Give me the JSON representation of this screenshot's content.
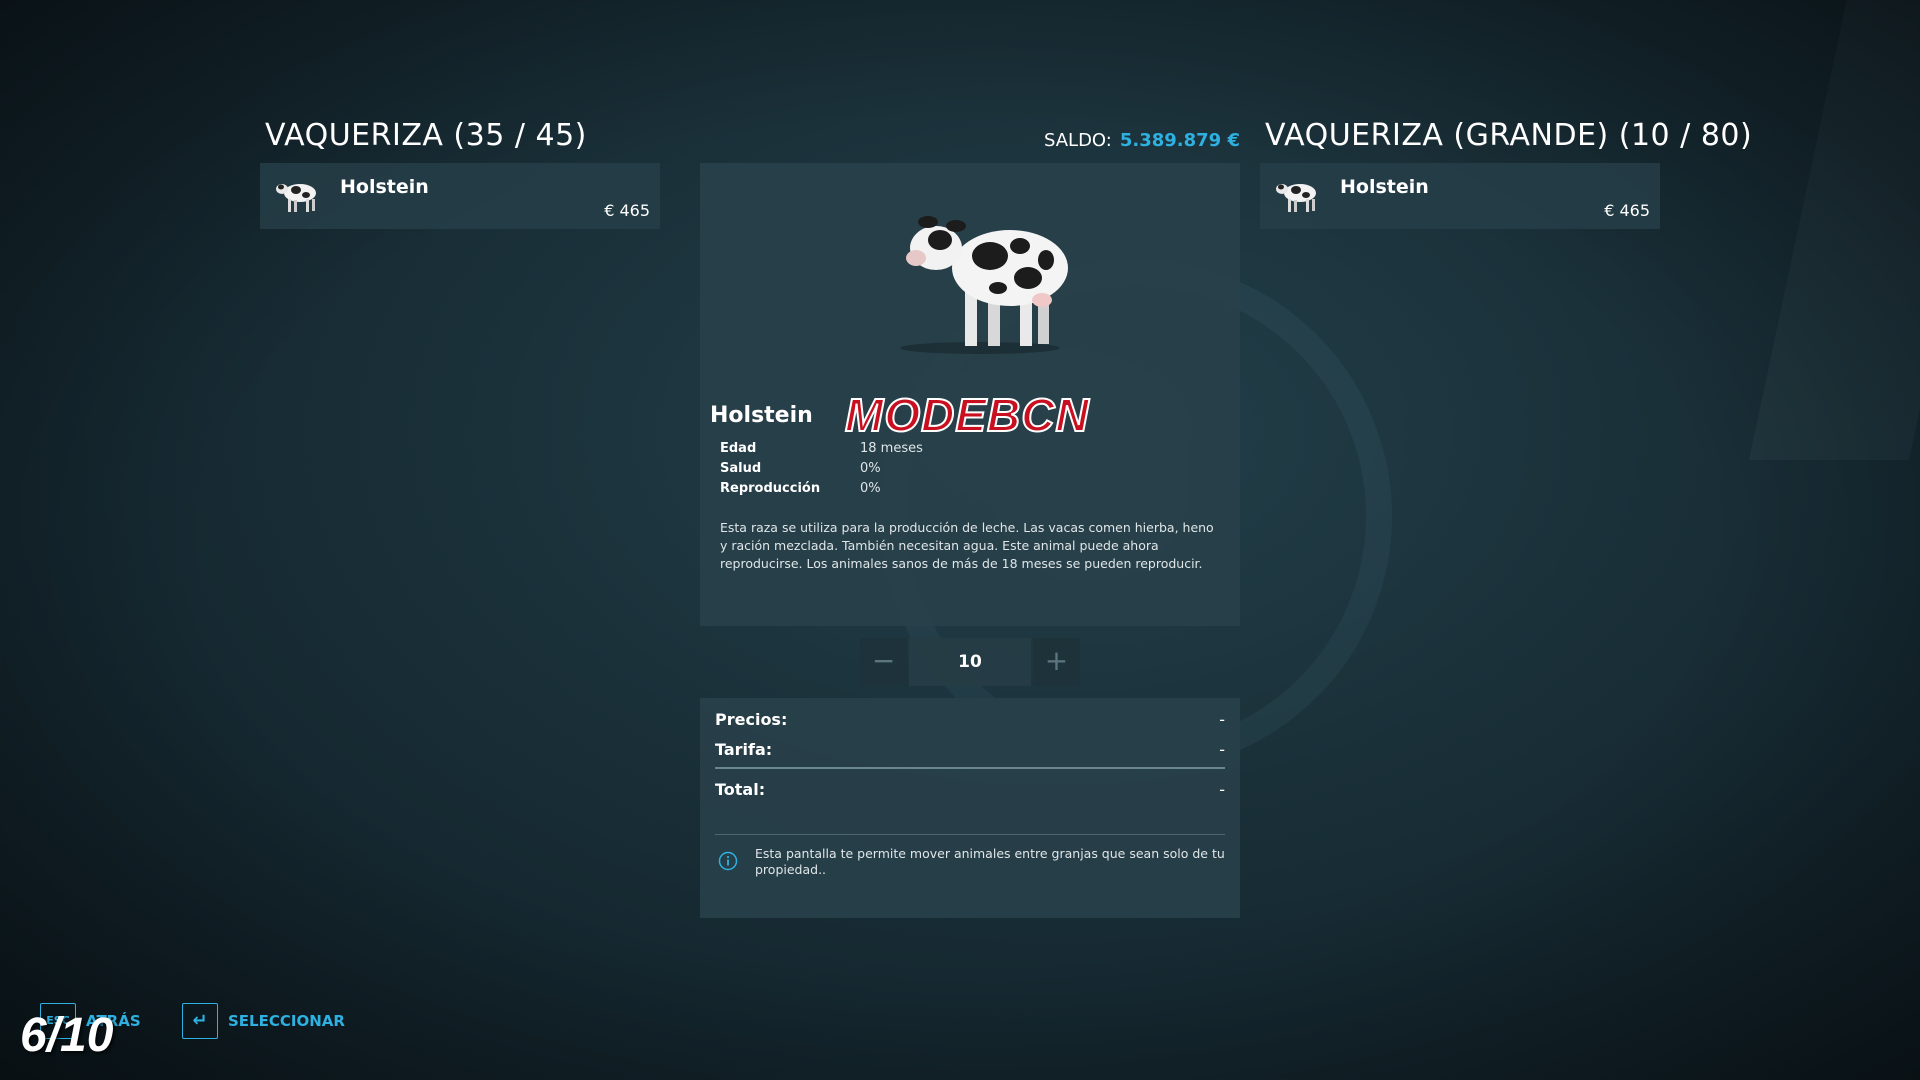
{
  "header": {
    "left_title": "VAQUERIZA (35 / 45)",
    "right_title": "VAQUERIZA (GRANDE) (10 / 80)",
    "balance_label": "SALDO:",
    "balance_value": "5.389.879 €"
  },
  "left_list": {
    "items": [
      {
        "name": "Holstein",
        "price": "€ 465"
      }
    ]
  },
  "right_list": {
    "items": [
      {
        "name": "Holstein",
        "price": "€ 465"
      }
    ]
  },
  "detail": {
    "name": "Holstein",
    "watermark": "MODEBCN",
    "stats": [
      {
        "label": "Edad",
        "value": "18 meses"
      },
      {
        "label": "Salud",
        "value": "0%"
      },
      {
        "label": "Reproducción",
        "value": "0%"
      }
    ],
    "description": "Esta raza se utiliza para la producción de leche. Las vacas comen hierba, heno y ración mezclada. También necesitan agua. Este animal puede ahora reproducirse. Los animales sanos de más de 18 meses se pueden reproducir."
  },
  "quantity": {
    "minus": "−",
    "value": "10",
    "plus": "+"
  },
  "prices": {
    "precios_label": "Precios:",
    "precios_value": "-",
    "tarifa_label": "Tarifa:",
    "tarifa_value": "-",
    "total_label": "Total:",
    "total_value": "-",
    "info_text": "Esta pantalla te permite mover animales entre granjas que sean solo de tu propiedad.."
  },
  "footer": {
    "back_key": "ESC",
    "back_label": "ATRÁS",
    "select_key": "↵",
    "select_label": "SELECCIONAR"
  },
  "overlay": {
    "page_counter": "6/10"
  },
  "colors": {
    "accent": "#2eb0e0",
    "panel": "#28404a",
    "watermark_red": "#c81020"
  }
}
